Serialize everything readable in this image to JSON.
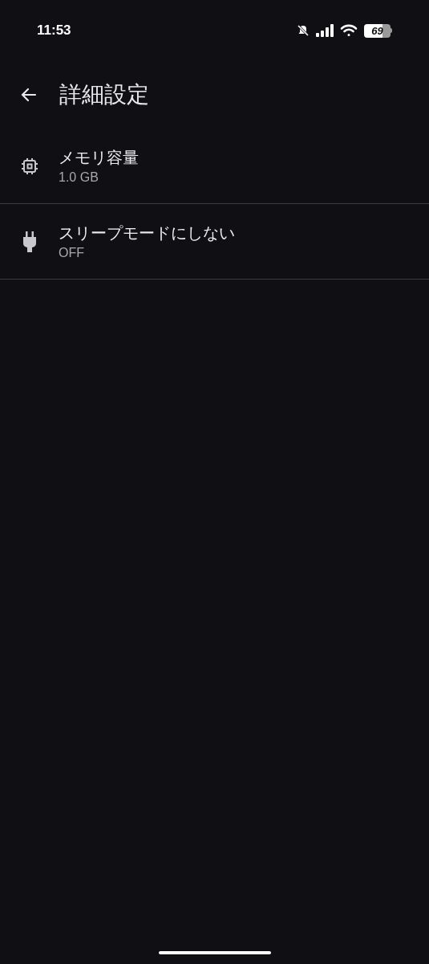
{
  "status_bar": {
    "time": "11:53",
    "battery": "69"
  },
  "header": {
    "title": "詳細設定"
  },
  "items": [
    {
      "kind": "memory",
      "title": "メモリ容量",
      "value": "1.0 GB"
    },
    {
      "kind": "power",
      "title": "スリープモードにしない",
      "value": "OFF"
    }
  ]
}
